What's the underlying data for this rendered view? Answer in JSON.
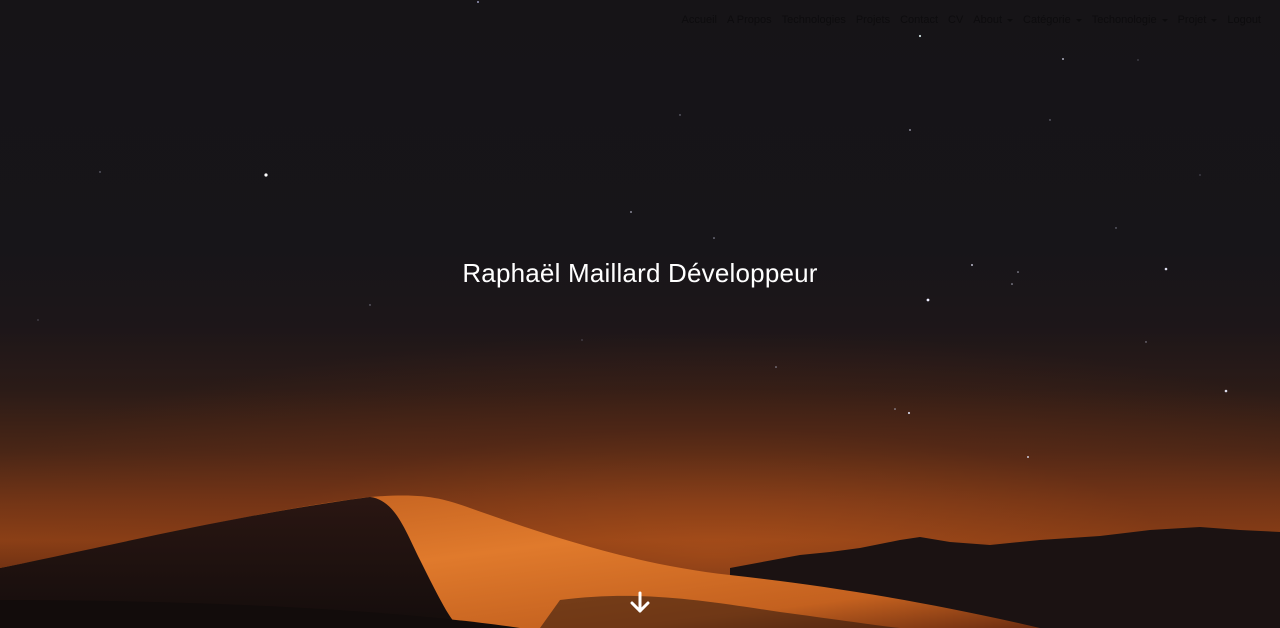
{
  "nav": {
    "items": [
      {
        "label": "Accueil",
        "dropdown": false
      },
      {
        "label": "A Propos",
        "dropdown": false
      },
      {
        "label": "Technologies",
        "dropdown": false
      },
      {
        "label": "Projets",
        "dropdown": false
      },
      {
        "label": "Contact",
        "dropdown": false
      },
      {
        "label": "CV",
        "dropdown": false
      },
      {
        "label": "About",
        "dropdown": true
      },
      {
        "label": "Catégorie",
        "dropdown": true
      },
      {
        "label": "Techonologie",
        "dropdown": true
      },
      {
        "label": "Projet",
        "dropdown": true
      },
      {
        "label": "Logout",
        "dropdown": false
      }
    ]
  },
  "hero": {
    "title": "Raphaël Maillard Développeur",
    "scroll_icon": "arrow-down-icon"
  },
  "colors": {
    "sky": "#171519",
    "horizon_glow": "#8c4016",
    "dune_light": "#e07a2c",
    "title_text": "#ffffff",
    "nav_text": "#0d0c0e"
  }
}
